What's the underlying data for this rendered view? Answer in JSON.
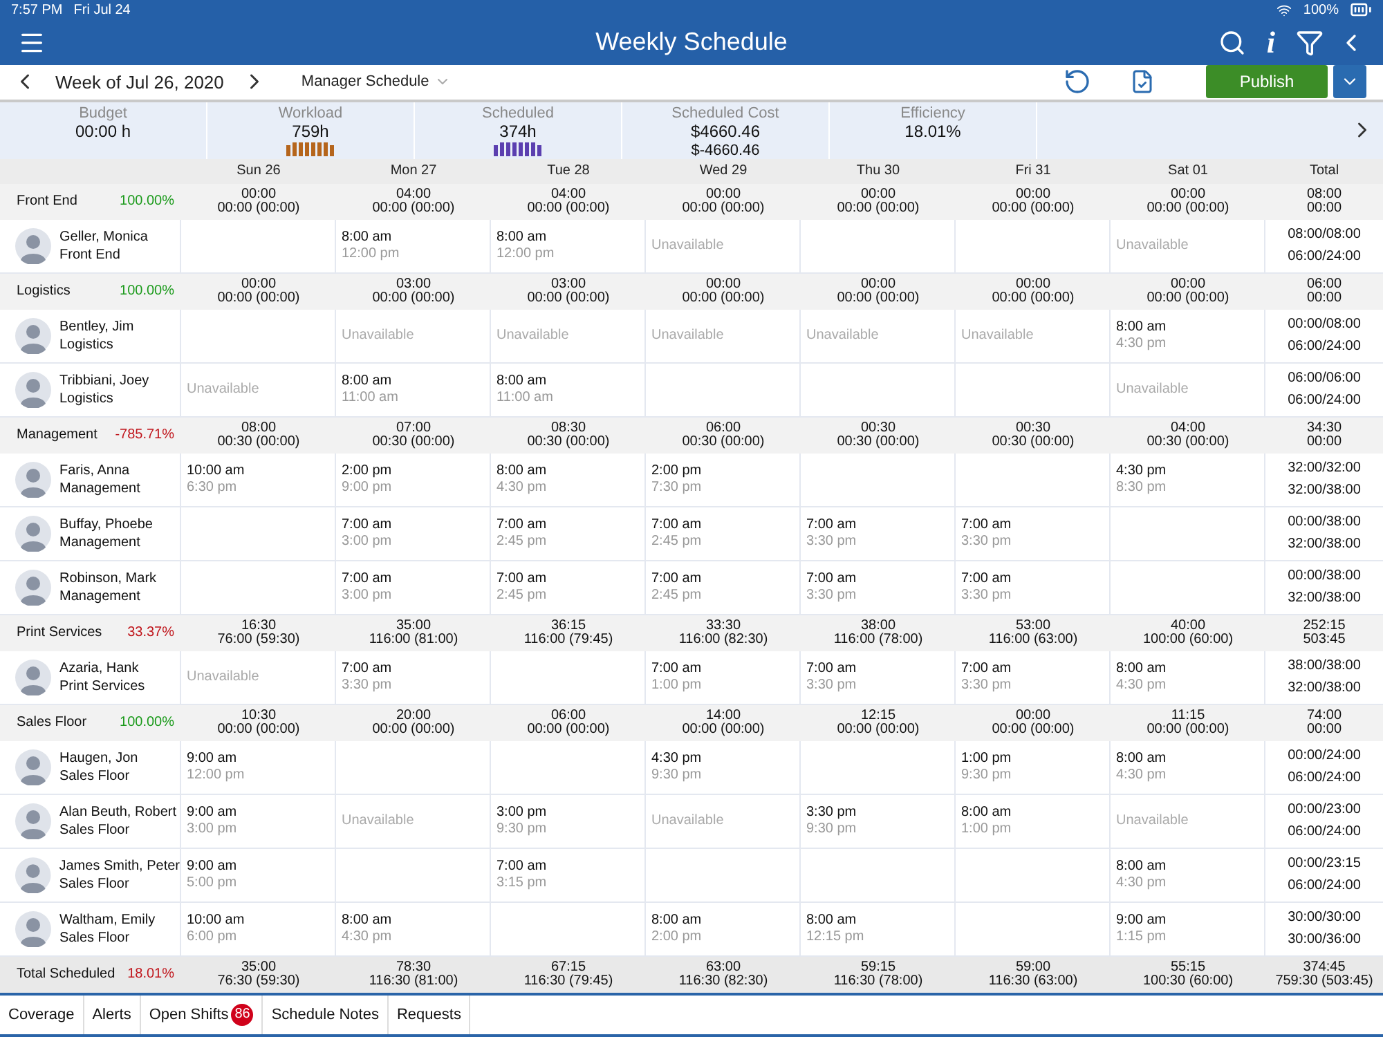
{
  "status_bar": {
    "time": "7:57 PM",
    "date": "Fri Jul 24",
    "battery": "100%"
  },
  "header": {
    "title": "Weekly Schedule",
    "info_glyph": "i"
  },
  "toolbar": {
    "week": "Week of Jul 26, 2020",
    "schedule": "Manager Schedule",
    "publish": "Publish"
  },
  "stats": [
    {
      "kind": "text",
      "label": "Budget",
      "value": "00:00 h"
    },
    {
      "kind": "bars",
      "label": "Workload",
      "value": "759h",
      "color": "#b5651d"
    },
    {
      "kind": "bars",
      "label": "Scheduled",
      "value": "374h",
      "color": "#5b3fb0"
    },
    {
      "kind": "cost",
      "label": "Scheduled Cost",
      "value": "$4660.46",
      "sub": "$-4660.46"
    },
    {
      "kind": "text",
      "label": "Efficiency",
      "value": "18.01%"
    }
  ],
  "columns": [
    "Sun 26",
    "Mon 27",
    "Tue 28",
    "Wed 29",
    "Thu 30",
    "Fri 31",
    "Sat 01",
    "Total"
  ],
  "groups": [
    {
      "name": "Front End",
      "pct": "100.00%",
      "color": "#1a9a1a",
      "days": [
        [
          "00:00",
          "00:00 (00:00)"
        ],
        [
          "04:00",
          "00:00 (00:00)"
        ],
        [
          "04:00",
          "00:00 (00:00)"
        ],
        [
          "00:00",
          "00:00 (00:00)"
        ],
        [
          "00:00",
          "00:00 (00:00)"
        ],
        [
          "00:00",
          "00:00 (00:00)"
        ],
        [
          "00:00",
          "00:00 (00:00)"
        ]
      ],
      "total": [
        "08:00",
        "00:00"
      ],
      "employees": [
        {
          "name": "Geller, Monica",
          "dept": "Front End",
          "shifts": [
            {
              "kind": "empty"
            },
            {
              "kind": "shift",
              "start": "8:00 am",
              "end": "12:00 pm"
            },
            {
              "kind": "shift",
              "start": "8:00 am",
              "end": "12:00 pm"
            },
            {
              "kind": "unavailable",
              "text": "Unavailable"
            },
            {
              "kind": "empty"
            },
            {
              "kind": "empty"
            },
            {
              "kind": "unavailable",
              "text": "Unavailable"
            }
          ],
          "total": [
            "08:00/08:00",
            "06:00/24:00"
          ]
        }
      ]
    },
    {
      "name": "Logistics",
      "pct": "100.00%",
      "color": "#1a9a1a",
      "days": [
        [
          "00:00",
          "00:00 (00:00)"
        ],
        [
          "03:00",
          "00:00 (00:00)"
        ],
        [
          "03:00",
          "00:00 (00:00)"
        ],
        [
          "00:00",
          "00:00 (00:00)"
        ],
        [
          "00:00",
          "00:00 (00:00)"
        ],
        [
          "00:00",
          "00:00 (00:00)"
        ],
        [
          "00:00",
          "00:00 (00:00)"
        ]
      ],
      "total": [
        "06:00",
        "00:00"
      ],
      "employees": [
        {
          "name": "Bentley, Jim",
          "dept": "Logistics",
          "shifts": [
            {
              "kind": "empty"
            },
            {
              "kind": "unavailable",
              "text": "Unavailable"
            },
            {
              "kind": "unavailable",
              "text": "Unavailable"
            },
            {
              "kind": "unavailable",
              "text": "Unavailable"
            },
            {
              "kind": "unavailable",
              "text": "Unavailable"
            },
            {
              "kind": "unavailable",
              "text": "Unavailable"
            },
            {
              "kind": "shift",
              "start": "8:00 am",
              "end": "4:30 pm"
            }
          ],
          "total": [
            "00:00/08:00",
            "06:00/24:00"
          ]
        },
        {
          "name": "Tribbiani, Joey",
          "dept": "Logistics",
          "shifts": [
            {
              "kind": "unavailable",
              "text": "Unavailable"
            },
            {
              "kind": "shift",
              "start": "8:00 am",
              "end": "11:00 am"
            },
            {
              "kind": "shift",
              "start": "8:00 am",
              "end": "11:00 am"
            },
            {
              "kind": "empty"
            },
            {
              "kind": "empty"
            },
            {
              "kind": "empty"
            },
            {
              "kind": "unavailable",
              "text": "Unavailable"
            }
          ],
          "total": [
            "06:00/06:00",
            "06:00/24:00"
          ]
        }
      ]
    },
    {
      "name": "Management",
      "pct": "-785.71%",
      "color": "#c0161c",
      "days": [
        [
          "08:00",
          "00:30 (00:00)"
        ],
        [
          "07:00",
          "00:30 (00:00)"
        ],
        [
          "08:30",
          "00:30 (00:00)"
        ],
        [
          "06:00",
          "00:30 (00:00)"
        ],
        [
          "00:30",
          "00:30 (00:00)"
        ],
        [
          "00:30",
          "00:30 (00:00)"
        ],
        [
          "04:00",
          "00:30 (00:00)"
        ]
      ],
      "total": [
        "34:30",
        "00:00"
      ],
      "employees": [
        {
          "name": "Faris, Anna",
          "dept": "Management",
          "shifts": [
            {
              "kind": "shift",
              "start": "10:00 am",
              "end": "6:30 pm"
            },
            {
              "kind": "shift",
              "start": "2:00 pm",
              "end": "9:00 pm"
            },
            {
              "kind": "shift",
              "start": "8:00 am",
              "end": "4:30 pm"
            },
            {
              "kind": "shift",
              "start": "2:00 pm",
              "end": "7:30 pm"
            },
            {
              "kind": "empty"
            },
            {
              "kind": "empty"
            },
            {
              "kind": "shift",
              "start": "4:30 pm",
              "end": "8:30 pm"
            }
          ],
          "total": [
            "32:00/32:00",
            "32:00/38:00"
          ]
        },
        {
          "name": "Buffay, Phoebe",
          "dept": "Management",
          "shifts": [
            {
              "kind": "empty"
            },
            {
              "kind": "shift",
              "start": "7:00 am",
              "end": "3:00 pm"
            },
            {
              "kind": "shift",
              "start": "7:00 am",
              "end": "2:45 pm"
            },
            {
              "kind": "shift",
              "start": "7:00 am",
              "end": "2:45 pm"
            },
            {
              "kind": "shift",
              "start": "7:00 am",
              "end": "3:30 pm"
            },
            {
              "kind": "shift",
              "start": "7:00 am",
              "end": "3:30 pm"
            },
            {
              "kind": "empty"
            }
          ],
          "total": [
            "00:00/38:00",
            "32:00/38:00"
          ]
        },
        {
          "name": "Robinson, Mark",
          "dept": "Management",
          "shifts": [
            {
              "kind": "empty"
            },
            {
              "kind": "shift",
              "start": "7:00 am",
              "end": "3:00 pm"
            },
            {
              "kind": "shift",
              "start": "7:00 am",
              "end": "2:45 pm"
            },
            {
              "kind": "shift",
              "start": "7:00 am",
              "end": "2:45 pm"
            },
            {
              "kind": "shift",
              "start": "7:00 am",
              "end": "3:30 pm"
            },
            {
              "kind": "shift",
              "start": "7:00 am",
              "end": "3:30 pm"
            },
            {
              "kind": "empty"
            }
          ],
          "total": [
            "00:00/38:00",
            "32:00/38:00"
          ]
        }
      ]
    },
    {
      "name": "Print Services",
      "pct": "33.37%",
      "color": "#c0161c",
      "days": [
        [
          "16:30",
          "76:00 (59:30)"
        ],
        [
          "35:00",
          "116:00 (81:00)"
        ],
        [
          "36:15",
          "116:00 (79:45)"
        ],
        [
          "33:30",
          "116:00 (82:30)"
        ],
        [
          "38:00",
          "116:00 (78:00)"
        ],
        [
          "53:00",
          "116:00 (63:00)"
        ],
        [
          "40:00",
          "100:00 (60:00)"
        ]
      ],
      "total": [
        "252:15",
        "503:45"
      ],
      "employees": [
        {
          "name": "Azaria, Hank",
          "dept": "Print Services",
          "shifts": [
            {
              "kind": "unavailable",
              "text": "Unavailable"
            },
            {
              "kind": "shift",
              "start": "7:00 am",
              "end": "3:30 pm"
            },
            {
              "kind": "empty"
            },
            {
              "kind": "shift",
              "start": "7:00 am",
              "end": "1:00 pm"
            },
            {
              "kind": "shift",
              "start": "7:00 am",
              "end": "3:30 pm"
            },
            {
              "kind": "shift",
              "start": "7:00 am",
              "end": "3:30 pm"
            },
            {
              "kind": "shift",
              "start": "8:00 am",
              "end": "4:30 pm"
            }
          ],
          "total": [
            "38:00/38:00",
            "32:00/38:00"
          ]
        }
      ]
    },
    {
      "name": "Sales Floor",
      "pct": "100.00%",
      "color": "#1a9a1a",
      "days": [
        [
          "10:30",
          "00:00 (00:00)"
        ],
        [
          "20:00",
          "00:00 (00:00)"
        ],
        [
          "06:00",
          "00:00 (00:00)"
        ],
        [
          "14:00",
          "00:00 (00:00)"
        ],
        [
          "12:15",
          "00:00 (00:00)"
        ],
        [
          "00:00",
          "00:00 (00:00)"
        ],
        [
          "11:15",
          "00:00 (00:00)"
        ]
      ],
      "total": [
        "74:00",
        "00:00"
      ],
      "employees": [
        {
          "name": "Haugen, Jon",
          "dept": "Sales Floor",
          "shifts": [
            {
              "kind": "shift",
              "start": "9:00 am",
              "end": "12:00 pm"
            },
            {
              "kind": "empty"
            },
            {
              "kind": "empty"
            },
            {
              "kind": "shift",
              "start": "4:30 pm",
              "end": "9:30 pm"
            },
            {
              "kind": "empty"
            },
            {
              "kind": "shift",
              "start": "1:00 pm",
              "end": "9:30 pm"
            },
            {
              "kind": "shift",
              "start": "8:00 am",
              "end": "4:30 pm"
            }
          ],
          "total": [
            "00:00/24:00",
            "06:00/24:00"
          ]
        },
        {
          "name": "Alan Beuth, Robert",
          "dept": "Sales Floor",
          "shifts": [
            {
              "kind": "shift",
              "start": "9:00 am",
              "end": "3:00 pm"
            },
            {
              "kind": "unavailable",
              "text": "Unavailable"
            },
            {
              "kind": "shift",
              "start": "3:00 pm",
              "end": "9:30 pm"
            },
            {
              "kind": "unavailable",
              "text": "Unavailable"
            },
            {
              "kind": "shift",
              "start": "3:30 pm",
              "end": "9:30 pm"
            },
            {
              "kind": "shift",
              "start": "8:00 am",
              "end": "1:00 pm"
            },
            {
              "kind": "unavailable",
              "text": "Unavailable"
            }
          ],
          "total": [
            "00:00/23:00",
            "06:00/24:00"
          ]
        },
        {
          "name": "James Smith, Peter",
          "dept": "Sales Floor",
          "shifts": [
            {
              "kind": "shift",
              "start": "9:00 am",
              "end": "5:00 pm"
            },
            {
              "kind": "empty"
            },
            {
              "kind": "shift",
              "start": "7:00 am",
              "end": "3:15 pm"
            },
            {
              "kind": "empty"
            },
            {
              "kind": "empty"
            },
            {
              "kind": "empty"
            },
            {
              "kind": "shift",
              "start": "8:00 am",
              "end": "4:30 pm"
            }
          ],
          "total": [
            "00:00/23:15",
            "06:00/24:00"
          ]
        },
        {
          "name": "Waltham, Emily",
          "dept": "Sales Floor",
          "shifts": [
            {
              "kind": "shift",
              "start": "10:00 am",
              "end": "6:00 pm"
            },
            {
              "kind": "shift",
              "start": "8:00 am",
              "end": "4:30 pm"
            },
            {
              "kind": "empty"
            },
            {
              "kind": "shift",
              "start": "8:00 am",
              "end": "2:00 pm"
            },
            {
              "kind": "shift",
              "start": "8:00 am",
              "end": "12:15 pm"
            },
            {
              "kind": "empty"
            },
            {
              "kind": "shift",
              "start": "9:00 am",
              "end": "1:15 pm"
            }
          ],
          "total": [
            "30:00/30:00",
            "30:00/36:00"
          ]
        }
      ]
    }
  ],
  "summary": {
    "name": "Total Scheduled",
    "pct": "18.01%",
    "color": "#c0161c",
    "days": [
      [
        "35:00",
        "76:30 (59:30)"
      ],
      [
        "78:30",
        "116:30 (81:00)"
      ],
      [
        "67:15",
        "116:30 (79:45)"
      ],
      [
        "63:00",
        "116:30 (82:30)"
      ],
      [
        "59:15",
        "116:30 (78:00)"
      ],
      [
        "59:00",
        "116:30 (63:00)"
      ],
      [
        "55:15",
        "100:30 (60:00)"
      ]
    ],
    "total": [
      "374:45",
      "759:30 (503:45)"
    ]
  },
  "bottom_tabs": [
    {
      "label": "Coverage",
      "selected": false
    },
    {
      "label": "Alerts",
      "selected": false
    },
    {
      "label": "Open Shifts",
      "badge": "86",
      "selected": false
    },
    {
      "label": "Schedule Notes",
      "selected": false
    },
    {
      "label": "Requests",
      "selected": false
    }
  ]
}
